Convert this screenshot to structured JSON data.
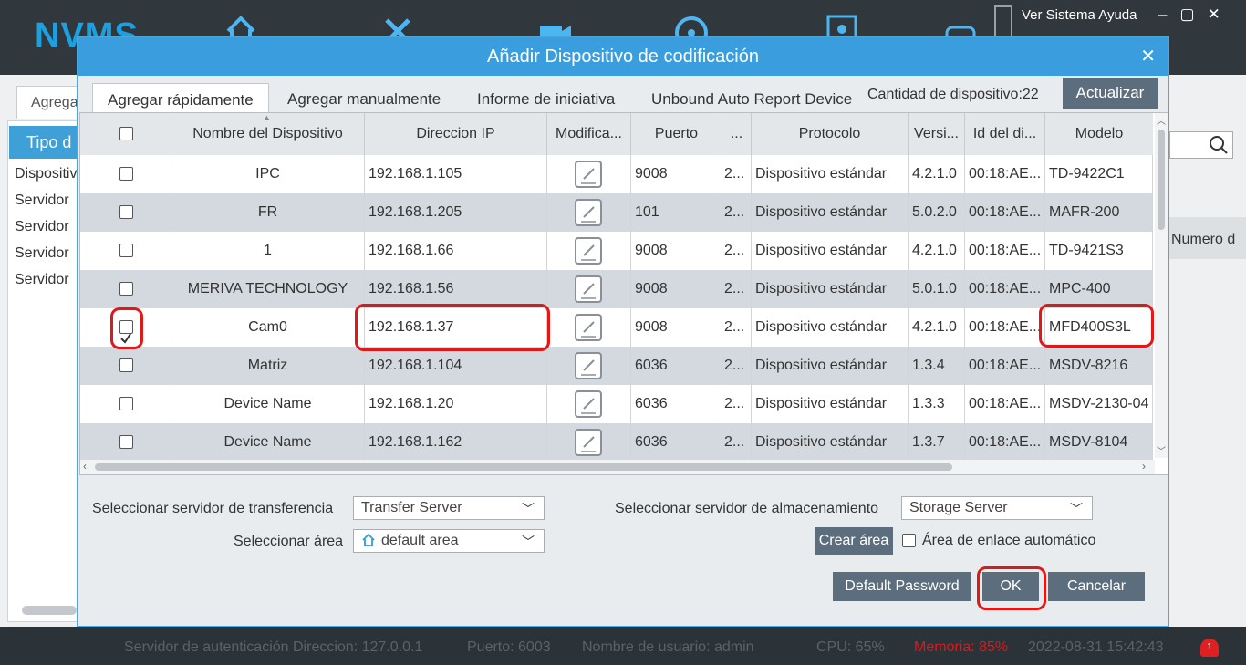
{
  "app": {
    "logo": "NVMS",
    "menu": "Ver  Sistema  Ayuda",
    "bg_tab": "Agrega",
    "bg_left_head": "Tipo d",
    "bg_items": [
      "Dispositiv",
      "Servidor",
      "Servidor",
      "Servidor",
      "Servidor"
    ],
    "bg_column": "Numero d"
  },
  "dialog": {
    "title": "Añadir Dispositivo de codificación",
    "tabs": [
      "Agregar rápidamente",
      "Agregar manualmente",
      "Informe de iniciativa",
      "Unbound Auto Report Device"
    ],
    "device_count": "Cantidad de dispositivo:22",
    "refresh_label": "Actualizar"
  },
  "table": {
    "headers": [
      "Nombre del Dispositivo",
      "Direccion IP",
      "Modifica...",
      "Puerto",
      "...",
      "Protocolo",
      "Versi...",
      "Id del di...",
      "Modelo"
    ],
    "rows": [
      {
        "checked": false,
        "name": "IPC",
        "ip": "192.168.1.105",
        "port": "9008",
        "col5": "2...",
        "protocol": "Dispositivo estándar",
        "version": "4.2.1.0",
        "id": "00:18:AE...",
        "model": "TD-9422C1"
      },
      {
        "checked": false,
        "name": "FR",
        "ip": "192.168.1.205",
        "port": "101",
        "col5": "2...",
        "protocol": "Dispositivo estándar",
        "version": "5.0.2.0",
        "id": "00:18:AE...",
        "model": "MAFR-200"
      },
      {
        "checked": false,
        "name": "1",
        "ip": "192.168.1.66",
        "port": "9008",
        "col5": "2...",
        "protocol": "Dispositivo estándar",
        "version": "4.2.1.0",
        "id": "00:18:AE...",
        "model": "TD-9421S3"
      },
      {
        "checked": false,
        "name": "MERIVA TECHNOLOGY",
        "ip": "192.168.1.56",
        "port": "9008",
        "col5": "2...",
        "protocol": "Dispositivo estándar",
        "version": "5.0.1.0",
        "id": "00:18:AE...",
        "model": "MPC-400"
      },
      {
        "checked": true,
        "name": "Cam0",
        "ip": "192.168.1.37",
        "port": "9008",
        "col5": "2...",
        "protocol": "Dispositivo estándar",
        "version": "4.2.1.0",
        "id": "00:18:AE...",
        "model": "MFD400S3L"
      },
      {
        "checked": false,
        "name": "Matriz",
        "ip": "192.168.1.104",
        "port": "6036",
        "col5": "2...",
        "protocol": "Dispositivo estándar",
        "version": "1.3.4",
        "id": "00:18:AE...",
        "model": "MSDV-8216"
      },
      {
        "checked": false,
        "name": "Device Name",
        "ip": "192.168.1.20",
        "port": "6036",
        "col5": "2...",
        "protocol": "Dispositivo estándar",
        "version": "1.3.3",
        "id": "00:18:AE...",
        "model": "MSDV-2130-04"
      },
      {
        "checked": false,
        "name": "Device Name",
        "ip": "192.168.1.162",
        "port": "6036",
        "col5": "2...",
        "protocol": "Dispositivo estándar",
        "version": "1.3.7",
        "id": "00:18:AE...",
        "model": "MSDV-8104"
      }
    ]
  },
  "form": {
    "transfer_label": "Seleccionar servidor de transferencia",
    "transfer_value": "Transfer Server",
    "storage_label": "Seleccionar servidor de almacenamiento",
    "storage_value": "Storage Server",
    "area_label": "Seleccionar área",
    "area_value": "default area",
    "create_area": "Crear área",
    "auto_link_label": "Área de enlace automático",
    "default_password": "Default Password",
    "ok": "OK",
    "cancel": "Cancelar"
  },
  "status": {
    "auth_server": "Servidor de autenticación Direccion: 127.0.0.1",
    "port": "Puerto: 6003",
    "user": "Nombre de usuario: admin",
    "cpu": "CPU: 65%",
    "memory": "Memoria: 85%",
    "datetime": "2022-08-31 15:42:43",
    "alarm_count": "1"
  },
  "colors": {
    "accent": "#3a9ede",
    "highlight": "#e01818",
    "button": "#5c6e7d",
    "memory_alert": "#e01818"
  }
}
